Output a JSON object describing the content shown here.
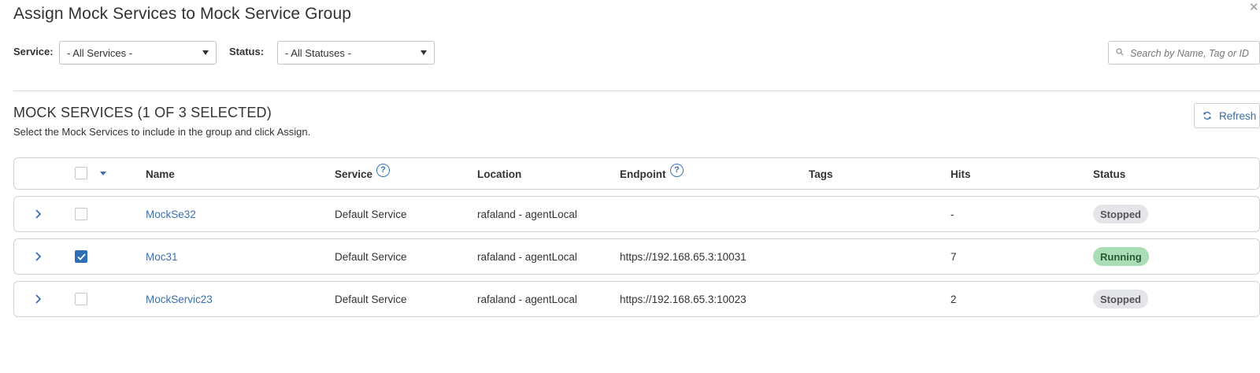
{
  "dialog": {
    "title": "Assign Mock Services to Mock Service Group",
    "close_icon": "close-icon"
  },
  "filters": {
    "service_label": "Service:",
    "service_value": "- All Services -",
    "status_label": "Status:",
    "status_value": "- All Statuses -",
    "search_placeholder": "Search by Name, Tag or ID",
    "search_value": ""
  },
  "section": {
    "title": "MOCK SERVICES (1 OF 3 SELECTED)",
    "subtitle": "Select the Mock Services to include in the group and click Assign.",
    "refresh_label": "Refresh"
  },
  "table": {
    "columns": {
      "name": "Name",
      "service": "Service",
      "location": "Location",
      "endpoint": "Endpoint",
      "tags": "Tags",
      "hits": "Hits",
      "status": "Status"
    },
    "rows": [
      {
        "name": "MockSe32",
        "service": "Default Service",
        "location": "rafaland - agentLocal",
        "endpoint": "",
        "tags": "",
        "hits": "-",
        "status": "Stopped",
        "checked": false
      },
      {
        "name": "Moc31",
        "service": "Default Service",
        "location": "rafaland - agentLocal",
        "endpoint": "https://192.168.65.3:10031",
        "tags": "",
        "hits": "7",
        "status": "Running",
        "checked": true
      },
      {
        "name": "MockServic23",
        "service": "Default Service",
        "location": "rafaland - agentLocal",
        "endpoint": "https://192.168.65.3:10023",
        "tags": "",
        "hits": "2",
        "status": "Stopped",
        "checked": false
      }
    ]
  },
  "colors": {
    "accent": "#3b6fb0",
    "checkbox_checked": "#2f6fb5",
    "badge_running": "#a8ddb5",
    "badge_stopped": "#e3e5e8"
  }
}
